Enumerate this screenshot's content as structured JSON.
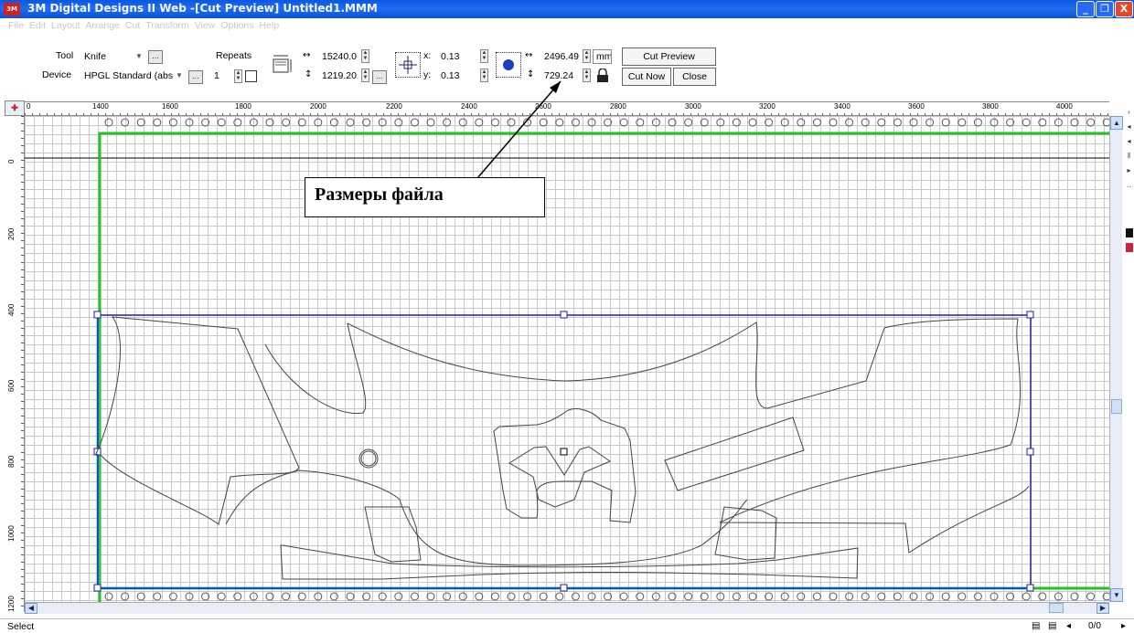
{
  "window": {
    "app_icon": "3M",
    "title": "3M Digital Designs II Web -[Cut Preview] Untitled1.MMM",
    "minimize": "_",
    "maximize": "❐",
    "close": "X"
  },
  "menu": [
    "File",
    "Edit",
    "Layout",
    "Arrange",
    "Cut",
    "Transform",
    "View",
    "Options",
    "Help"
  ],
  "toolbar": {
    "tool_label": "Tool",
    "tool_value": "Knife",
    "device_label": "Device",
    "device_value": "HPGL Standard (abs",
    "repeats_label": "Repeats",
    "repeats_value": "1",
    "media_width": "15240.0",
    "media_height": "1219.20",
    "offset_x_label": "x:",
    "offset_x": "0.13",
    "offset_y_label": "y:",
    "offset_y": "0.13",
    "size_width": "2496.49",
    "size_height": "729.24",
    "unit": "mm",
    "cut_preview": "Cut Preview",
    "cut_now": "Cut Now",
    "close": "Close",
    "browse": "..."
  },
  "ruler": {
    "corner": "✚",
    "h_labels": [
      "0",
      "1400",
      "1600",
      "1800",
      "2000",
      "2200",
      "2400",
      "2600",
      "2800",
      "3000",
      "3200",
      "3400",
      "3600",
      "3800",
      "4000"
    ],
    "v_labels": [
      "0",
      "200",
      "400",
      "600",
      "800",
      "1000",
      "1200"
    ]
  },
  "annotation": {
    "text": "Размеры файла"
  },
  "status": {
    "mode": "Select",
    "page": "0/0"
  },
  "colors": {
    "title_bar": "#0c52d6",
    "media_edge": "#22c422",
    "selection": "#2020a0",
    "page_edge": "#2ad0d0",
    "grid": "#c9c9c9"
  }
}
